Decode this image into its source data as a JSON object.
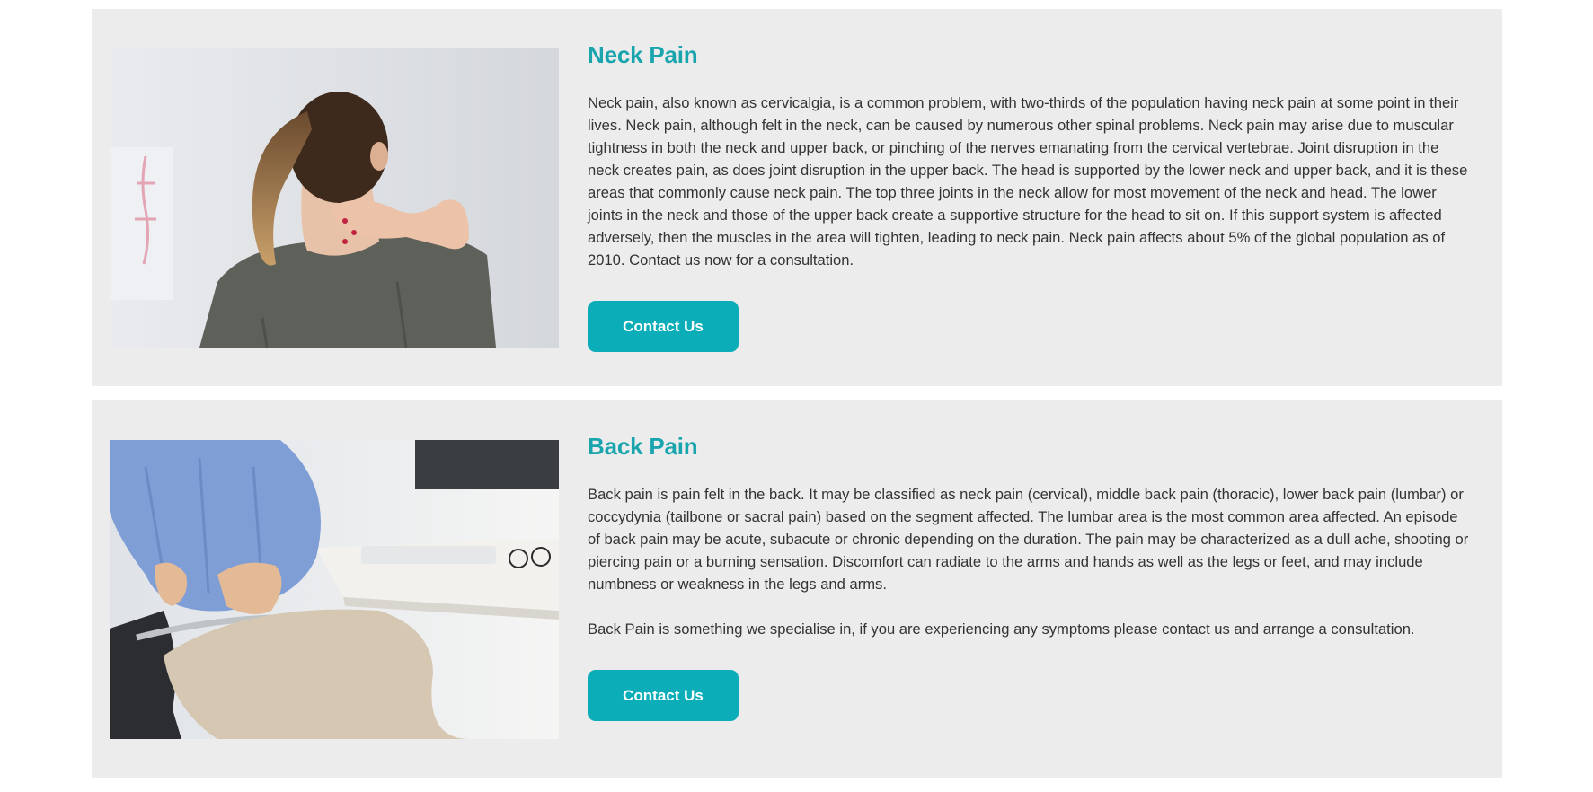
{
  "sections": [
    {
      "title": "Neck Pain",
      "paragraphs": [
        "Neck pain, also known as cervicalgia, is a common problem, with two-thirds of the population having neck pain at some point in their lives. Neck pain, although felt in the neck, can be caused by numerous other spinal problems. Neck pain may arise due to muscular tightness in both the neck and upper back, or pinching of the nerves emanating from the cervical vertebrae. Joint disruption in the neck creates pain, as does joint disruption in the upper back. The head is supported by the lower neck and upper back, and it is these areas that commonly cause neck pain. The top three joints in the neck allow for most movement of the neck and head. The lower joints in the neck and those of the upper back create a supportive structure for the head to sit on. If this support system is affected adversely, then the muscles in the area will tighten, leading to neck pain. Neck pain affects about 5% of the global population as of 2010. Contact us now for a consultation."
      ],
      "button_label": "Contact Us"
    },
    {
      "title": "Back Pain",
      "paragraphs": [
        "Back pain is pain felt in the back. It may be classified as neck pain (cervical), middle back pain (thoracic), lower back pain (lumbar) or coccydynia (tailbone or sacral pain) based on the segment affected. The lumbar area is the most common area affected. An episode of back pain may be acute, subacute or chronic depending on the duration. The pain may be characterized as a dull ache, shooting or piercing pain or a burning sensation. Discomfort can radiate to the arms and hands as well as the legs or feet, and may include numbness or weakness in the legs and arms.",
        "Back Pain is something we specialise in, if you are experiencing any symptoms please contact us and arrange a consultation."
      ],
      "button_label": "Contact Us"
    }
  ],
  "colors": {
    "accent": "#1aa5ae",
    "button": "#0badb8",
    "card_background": "#ececec",
    "text": "#333333"
  }
}
